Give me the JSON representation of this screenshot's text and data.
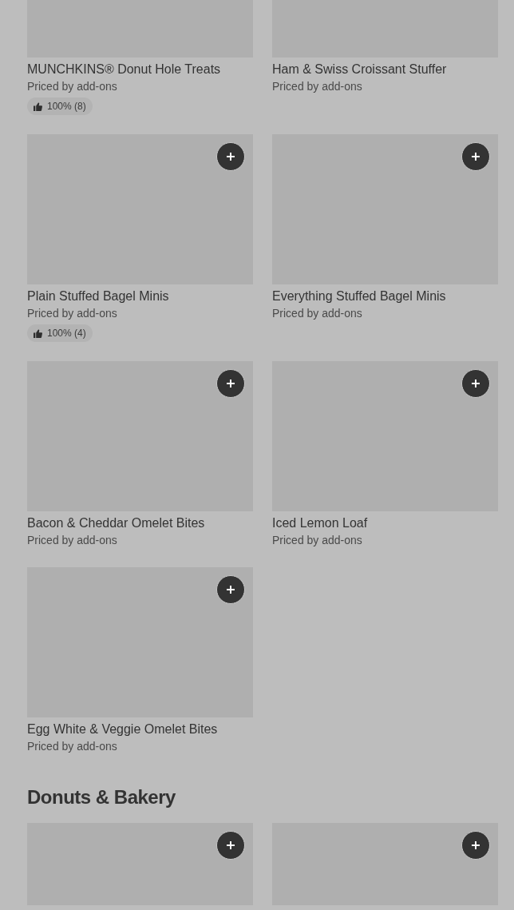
{
  "sections": [
    {
      "items": [
        {
          "kind": "cut_top",
          "name": "MUNCHKINS® Donut Hole Treats",
          "price": "Priced by add-ons",
          "rating": "100% (8)"
        },
        {
          "kind": "cut_top",
          "name": "Ham & Swiss Croissant Stuffer",
          "price": "Priced by add-ons"
        },
        {
          "kind": "full",
          "name": "Plain Stuffed Bagel Minis",
          "price": "Priced by add-ons",
          "rating": "100% (4)"
        },
        {
          "kind": "full",
          "name": "Everything Stuffed Bagel Minis",
          "price": "Priced by add-ons"
        },
        {
          "kind": "full",
          "name": "Bacon & Cheddar Omelet Bites",
          "price": "Priced by add-ons"
        },
        {
          "kind": "full",
          "name": "Iced Lemon Loaf",
          "price": "Priced by add-ons"
        },
        {
          "kind": "full",
          "name": "Egg White & Veggie Omelet Bites",
          "price": "Priced by add-ons"
        }
      ]
    },
    {
      "title": "Donuts & Bakery",
      "items": [
        {
          "kind": "cut_bottom"
        },
        {
          "kind": "cut_bottom"
        }
      ]
    }
  ]
}
